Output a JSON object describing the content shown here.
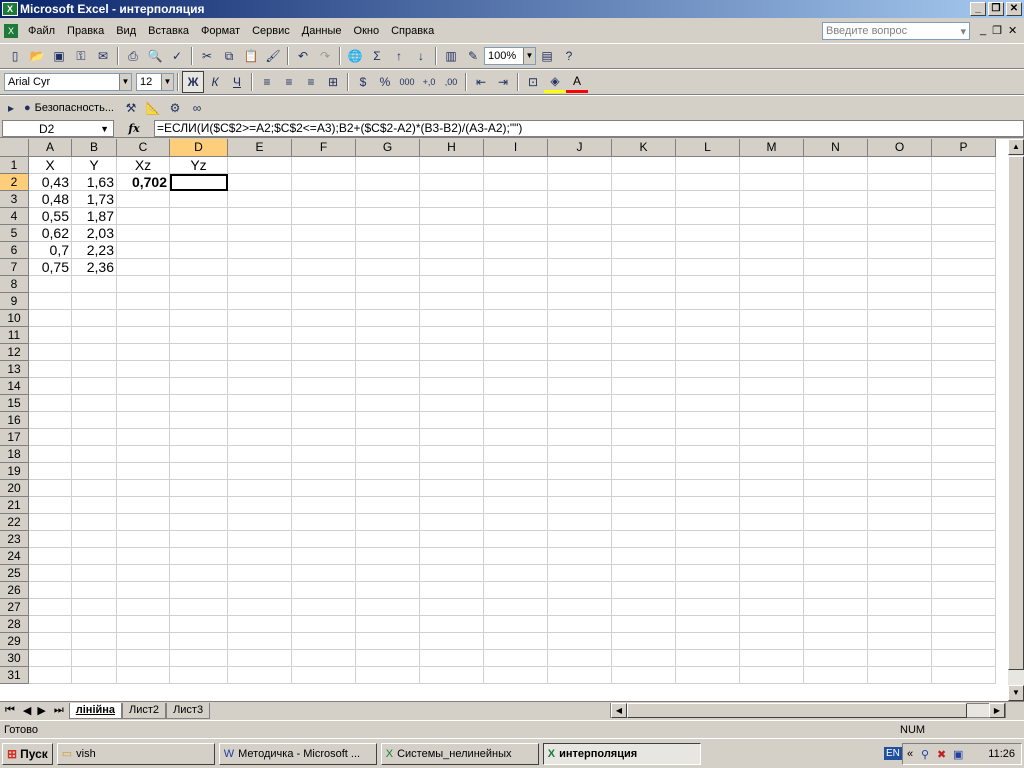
{
  "window": {
    "title": "Microsoft Excel - интерполяция"
  },
  "menu": [
    "Файл",
    "Правка",
    "Вид",
    "Вставка",
    "Формат",
    "Сервис",
    "Данные",
    "Окно",
    "Справка"
  ],
  "ask_placeholder": "Введите вопрос",
  "toolbar": {
    "zoom": "100%",
    "font": "Arial Cyr",
    "size": "12",
    "bold": "Ж",
    "italic": "К",
    "underline": "Ч",
    "security": "Безопасность..."
  },
  "namebox": "D2",
  "formula": "=ЕСЛИ(И($C$2>=A2;$C$2<=A3);B2+($C$2-A2)*(B3-B2)/(A3-A2);\"\")",
  "columns": [
    "A",
    "B",
    "C",
    "D",
    "E",
    "F",
    "G",
    "H",
    "I",
    "J",
    "K",
    "L",
    "M",
    "N",
    "O",
    "P"
  ],
  "rows": [
    "1",
    "2",
    "3",
    "4",
    "5",
    "6",
    "7",
    "8",
    "9",
    "10",
    "11",
    "12",
    "13",
    "14",
    "15",
    "16",
    "17",
    "18",
    "19",
    "20",
    "21",
    "22",
    "23",
    "24",
    "25",
    "26",
    "27",
    "28",
    "29",
    "30",
    "31"
  ],
  "cells": {
    "A1": "X",
    "B1": "Y",
    "C1": "Xz",
    "D1": "Yz",
    "A2": "0,43",
    "B2": "1,63",
    "C2": "0,702",
    "A3": "0,48",
    "B3": "1,73",
    "A4": "0,55",
    "B4": "1,87",
    "A5": "0,62",
    "B5": "2,03",
    "A6": "0,7",
    "B6": "2,23",
    "A7": "0,75",
    "B7": "2,36"
  },
  "sheets": [
    "лiнiйна",
    "Лист2",
    "Лист3"
  ],
  "status": {
    "left": "Готово",
    "num": "NUM"
  },
  "taskbar": {
    "start": "Пуск",
    "tasks": [
      "vish",
      "Методичка - Microsoft ...",
      "Системы_нелинейных",
      "интерполяция"
    ],
    "lang": "EN",
    "clock": "11:26"
  }
}
